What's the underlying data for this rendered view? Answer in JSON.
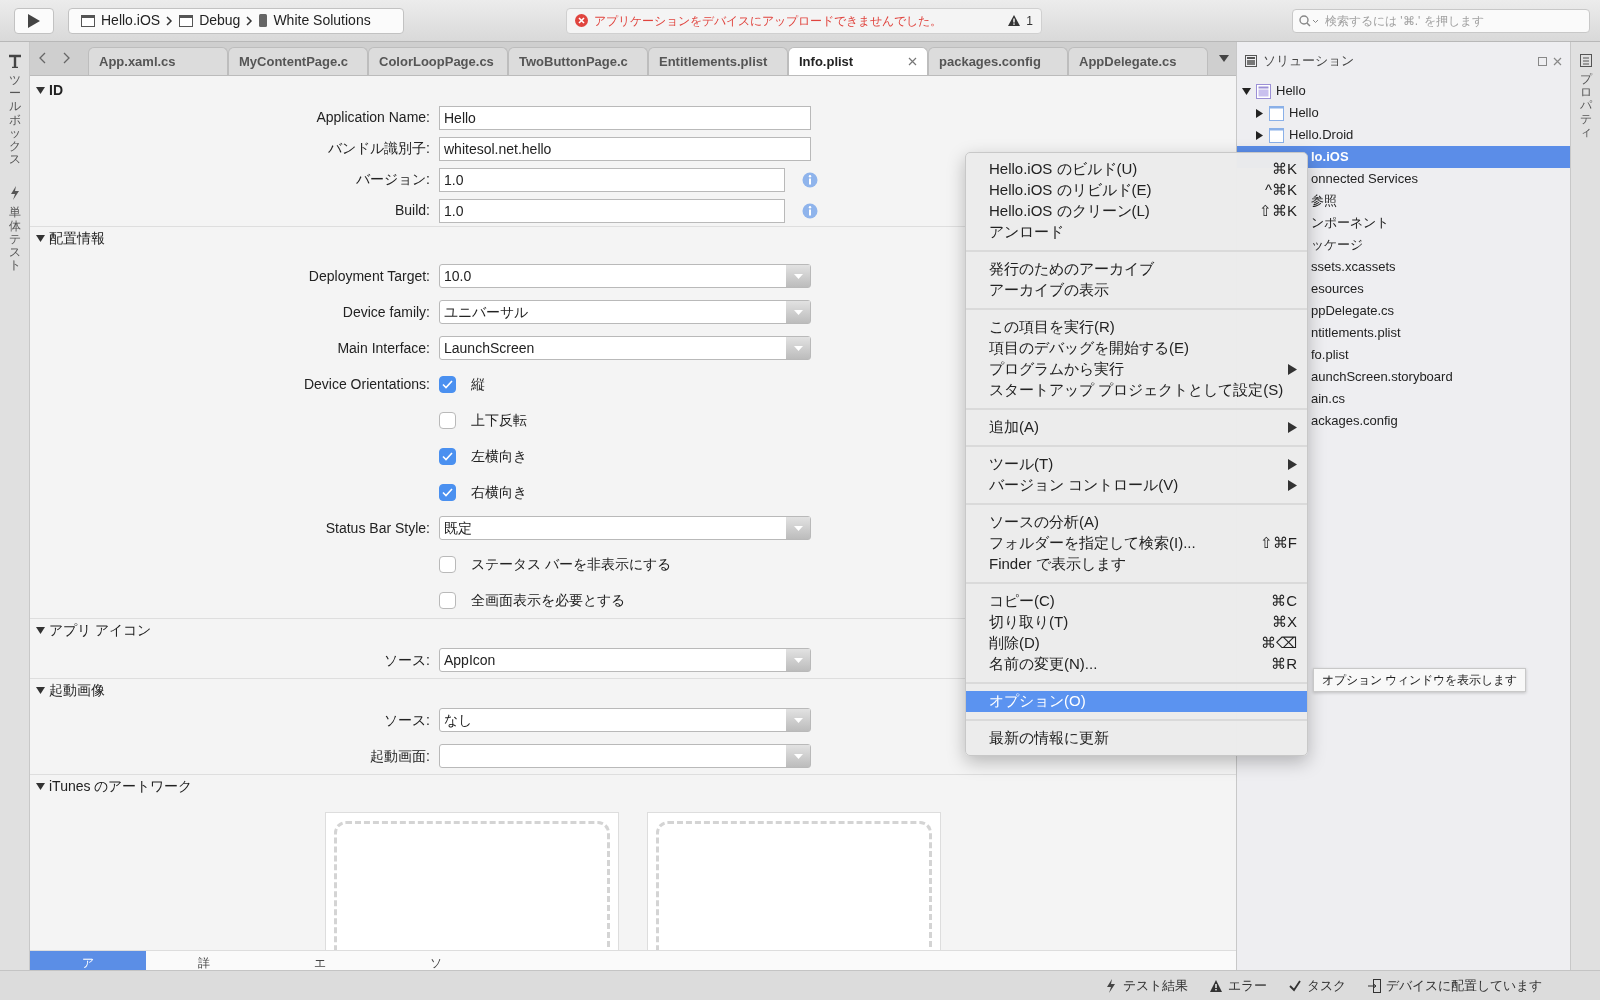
{
  "toolbar": {
    "breadcrumb": [
      "Hello.iOS",
      "Debug",
      "White Solutions"
    ],
    "status_message": "アプリケーションをデバイスにアップロードできませんでした。",
    "warning_count": "1",
    "search": {
      "placeholder": "検索するには '⌘.' を押します"
    }
  },
  "left_pads": [
    {
      "label": "ツールボックス",
      "kind": "toolbox"
    },
    {
      "label": "単体テスト",
      "kind": "tests"
    }
  ],
  "tabs": [
    {
      "label": "App.xaml.cs",
      "selected": false
    },
    {
      "label": "MyContentPage.c",
      "selected": false
    },
    {
      "label": "ColorLoopPage.cs",
      "selected": false
    },
    {
      "label": "TwoButtonPage.c",
      "selected": false
    },
    {
      "label": "Entitlements.plist",
      "selected": false
    },
    {
      "label": "Info.plist",
      "selected": true
    },
    {
      "label": "packages.config",
      "selected": false
    },
    {
      "label": "AppDelegate.cs",
      "selected": false
    }
  ],
  "sections": [
    {
      "title": "ID",
      "expanded": true,
      "rows": [
        {
          "kind": "text",
          "label": "Application Name:",
          "value": "Hello"
        },
        {
          "kind": "text",
          "label": "バンドル識別子:",
          "value": "whitesol.net.hello"
        },
        {
          "kind": "text",
          "label": "バージョン:",
          "value": "1.0",
          "info": true
        },
        {
          "kind": "text",
          "label": "Build:",
          "value": "1.0",
          "info": true
        }
      ]
    },
    {
      "title": "配置情報",
      "expanded": true,
      "rows": [
        {
          "kind": "select",
          "label": "Deployment Target:",
          "value": "10.0"
        },
        {
          "kind": "select",
          "label": "Device family:",
          "value": "ユニバーサル"
        },
        {
          "kind": "select",
          "label": "Main Interface:",
          "value": "LaunchScreen"
        },
        {
          "kind": "checkbox",
          "label": "Device Orientations:",
          "text": "縦",
          "checked": true
        },
        {
          "kind": "checkbox",
          "text": "上下反転",
          "checked": false
        },
        {
          "kind": "checkbox",
          "text": "左横向き",
          "checked": true
        },
        {
          "kind": "checkbox",
          "text": "右横向き",
          "checked": true
        },
        {
          "kind": "select",
          "label": "Status Bar Style:",
          "value": "既定"
        },
        {
          "kind": "checkbox",
          "text": "ステータス バーを非表示にする",
          "checked": false
        },
        {
          "kind": "checkbox",
          "text": "全画面表示を必要とする",
          "checked": false
        }
      ]
    },
    {
      "title": "アプリ アイコン",
      "expanded": true,
      "rows": [
        {
          "kind": "select",
          "label": "ソース:",
          "value": "AppIcon"
        }
      ]
    },
    {
      "title": "起動画像",
      "expanded": true,
      "rows": [
        {
          "kind": "select",
          "label": "ソース:",
          "value": "なし"
        },
        {
          "kind": "select",
          "label": "起動画面:"
        }
      ]
    },
    {
      "title": "iTunes のアートワーク",
      "expanded": true,
      "rows": [
        {
          "kind": "artwork"
        }
      ]
    }
  ],
  "bottom_tabs": [
    {
      "label": "ア",
      "selected": true
    },
    {
      "label": "詳",
      "selected": false
    },
    {
      "label": "エ",
      "selected": false
    },
    {
      "label": "ソ",
      "selected": false
    }
  ],
  "solution": {
    "title": "ソリューション",
    "tree": [
      {
        "label": "Hello",
        "expanded": true,
        "selected": false,
        "children": [
          {
            "label": "Hello",
            "expanded": false,
            "selected": false
          },
          {
            "label": "Hello.Droid",
            "expanded": false,
            "selected": false
          },
          {
            "label": "lo.iOS",
            "selected": true,
            "children": [
              {
                "label": "onnected Services",
                "selected": false
              },
              {
                "label": "参照",
                "selected": false
              },
              {
                "label": "ンポーネント",
                "selected": false
              },
              {
                "label": "ッケージ",
                "selected": false
              },
              {
                "label": "ssets.xcassets",
                "selected": false
              },
              {
                "label": "esources",
                "selected": false
              },
              {
                "label": "ppDelegate.cs",
                "selected": false
              },
              {
                "label": "ntitlements.plist",
                "selected": false
              },
              {
                "label": "fo.plist",
                "selected": false
              },
              {
                "label": "aunchScreen.storyboard",
                "selected": false
              },
              {
                "label": "ain.cs",
                "selected": false
              },
              {
                "label": "ackages.config",
                "selected": false
              }
            ]
          }
        ]
      }
    ]
  },
  "properties_pad": {
    "label": "プロパティ"
  },
  "context_menu": {
    "groups": [
      [
        {
          "label": "Hello.iOS のビルド(U)",
          "shortcut": "⌘K",
          "submenu": false,
          "selected": false
        },
        {
          "label": "Hello.iOS のリビルド(E)",
          "shortcut": "^⌘K",
          "submenu": false,
          "selected": false
        },
        {
          "label": "Hello.iOS のクリーン(L)",
          "shortcut": "⇧⌘K",
          "submenu": false,
          "selected": false
        },
        {
          "label": "アンロード",
          "submenu": false,
          "selected": false
        }
      ],
      [
        {
          "label": "発行のためのアーカイブ",
          "submenu": false,
          "selected": false
        },
        {
          "label": "アーカイブの表示",
          "submenu": false,
          "selected": false
        }
      ],
      [
        {
          "label": "この項目を実行(R)",
          "submenu": false,
          "selected": false
        },
        {
          "label": "項目のデバッグを開始する(E)",
          "submenu": false,
          "selected": false
        },
        {
          "label": "プログラムから実行",
          "submenu": true,
          "selected": false
        },
        {
          "label": "スタートアップ プロジェクトとして設定(S)",
          "submenu": false,
          "selected": false
        }
      ],
      [
        {
          "label": "追加(A)",
          "submenu": true,
          "selected": false
        }
      ],
      [
        {
          "label": "ツール(T)",
          "submenu": true,
          "selected": false
        },
        {
          "label": "バージョン コントロール(V)",
          "submenu": true,
          "selected": false
        }
      ],
      [
        {
          "label": "ソースの分析(A)",
          "submenu": false,
          "selected": false
        },
        {
          "label": "フォルダーを指定して検索(I)...",
          "shortcut": "⇧⌘F",
          "submenu": false,
          "selected": false
        },
        {
          "label": "Finder で表示します",
          "submenu": false,
          "selected": false
        }
      ],
      [
        {
          "label": "コピー(C)",
          "shortcut": "⌘C",
          "submenu": false,
          "selected": false
        },
        {
          "label": "切り取り(T)",
          "shortcut": "⌘X",
          "submenu": false,
          "selected": false
        },
        {
          "label": "削除(D)",
          "shortcut": "⌘⌫",
          "submenu": false,
          "selected": false
        },
        {
          "label": "名前の変更(N)...",
          "shortcut": "⌘R",
          "submenu": false,
          "selected": false
        }
      ],
      [
        {
          "label": "オプション(O)",
          "submenu": false,
          "selected": true
        }
      ],
      [
        {
          "label": "最新の情報に更新",
          "submenu": false,
          "selected": false
        }
      ]
    ],
    "tooltip": "オプション ウィンドウを表示します"
  },
  "status_bar": [
    {
      "label": "テスト結果",
      "kind": "tests"
    },
    {
      "label": "エラー",
      "kind": "errors"
    },
    {
      "label": "タスク",
      "kind": "tasks"
    },
    {
      "label": "デバイスに配置しています",
      "kind": "deploy"
    }
  ]
}
